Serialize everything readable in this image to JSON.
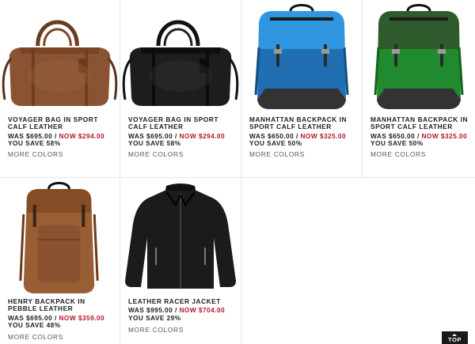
{
  "products": [
    {
      "name": "VOYAGER BAG IN SPORT CALF LEATHER",
      "was_label": "WAS",
      "was_price": "$695.00",
      "separator": "/",
      "now_label": "NOW",
      "now_price": "$294.00",
      "save_text": "YOU SAVE 58%",
      "more_colors": "MORE COLORS",
      "image_icon": "duffle-bag-brown-image",
      "color": "#8a5434"
    },
    {
      "name": "VOYAGER BAG IN SPORT CALF LEATHER",
      "was_label": "WAS",
      "was_price": "$695.00",
      "separator": "/",
      "now_label": "NOW",
      "now_price": "$294.00",
      "save_text": "YOU SAVE 58%",
      "more_colors": "MORE COLORS",
      "image_icon": "duffle-bag-black-image",
      "color": "#1d1d1d"
    },
    {
      "name": "MANHATTAN BACKPACK IN SPORT CALF LEATHER",
      "was_label": "WAS",
      "was_price": "$650.00",
      "separator": "/",
      "now_label": "NOW",
      "now_price": "$325.00",
      "save_text": "YOU SAVE 50%",
      "more_colors": "MORE COLORS",
      "image_icon": "backpack-blue-image",
      "color": "#1f6fb2"
    },
    {
      "name": "MANHATTAN BACKPACK IN SPORT CALF LEATHER",
      "was_label": "WAS",
      "was_price": "$650.00",
      "separator": "/",
      "now_label": "NOW",
      "now_price": "$325.00",
      "save_text": "YOU SAVE 50%",
      "more_colors": "MORE COLORS",
      "image_icon": "backpack-green-image",
      "color": "#1f8a2e"
    },
    {
      "name": "HENRY BACKPACK IN PEBBLE LEATHER",
      "was_label": "WAS",
      "was_price": "$695.00",
      "separator": "/",
      "now_label": "NOW",
      "now_price": "$359.00",
      "save_text": "YOU SAVE 48%",
      "more_colors": "MORE COLORS",
      "image_icon": "backpack-tan-image",
      "color": "#9a5e34"
    },
    {
      "name": "LEATHER RACER JACKET",
      "was_label": "WAS",
      "was_price": "$995.00",
      "separator": "/",
      "now_label": "NOW",
      "now_price": "$704.00",
      "save_text": "YOU SAVE 29%",
      "more_colors": "MORE COLORS",
      "image_icon": "leather-jacket-black-image",
      "color": "#1b1b1b"
    }
  ],
  "back_to_top": {
    "label": "TOP",
    "icon": "arrow-up-icon"
  },
  "colors": {
    "sale_red": "#b3162b",
    "divider": "#e6e6e6"
  }
}
